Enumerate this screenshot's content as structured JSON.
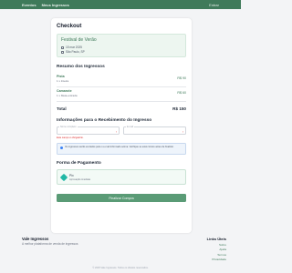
{
  "nav": {
    "items": [
      "Eventos",
      "Meus Ingressos"
    ],
    "right": "Entrar"
  },
  "checkout": {
    "title": "Checkout",
    "event": {
      "name": "Festival de Verão",
      "date": "15 mar 2025",
      "location": "São Paulo, SP"
    },
    "tickets_title": "Resumo dos Ingressos",
    "tickets": [
      {
        "name": "Pista",
        "sub": "1 x Inteira",
        "price": "R$ 90"
      },
      {
        "name": "Camarote",
        "sub": "1 x Meia-entrada",
        "price": "R$ 60"
      }
    ],
    "total_label": "Total",
    "total_value": "R$ 150",
    "recipient_title": "Informações para o Recebimento do Ingresso",
    "fields": [
      {
        "label": "Nome completo",
        "value": ""
      },
      {
        "label": "E-mail",
        "value": ""
      }
    ],
    "error": "Este campo é obrigatório.",
    "info": "Os ingressos serão enviados para o e-mail informado acima. Verifique se está correto antes de finalizar.",
    "payment_title": "Forma de Pagamento",
    "payment": {
      "name": "Pix",
      "sub": "Aprovação imediata"
    },
    "submit": "Finalizar Compra"
  },
  "footer": {
    "brand": "Vale Ingressos",
    "tagline": "A melhor plataforma de venda de ingressos",
    "right_head": "Links Úteis",
    "links": [
      "Sobre",
      "Ajuda",
      "Termos",
      "Privacidade"
    ],
    "copyright": "© 2025 Vale Ingressos. Todos os direitos reservados."
  },
  "colors": {
    "brand": "#3f7a5a",
    "button": "#5a9b76",
    "error": "#dc2626"
  }
}
